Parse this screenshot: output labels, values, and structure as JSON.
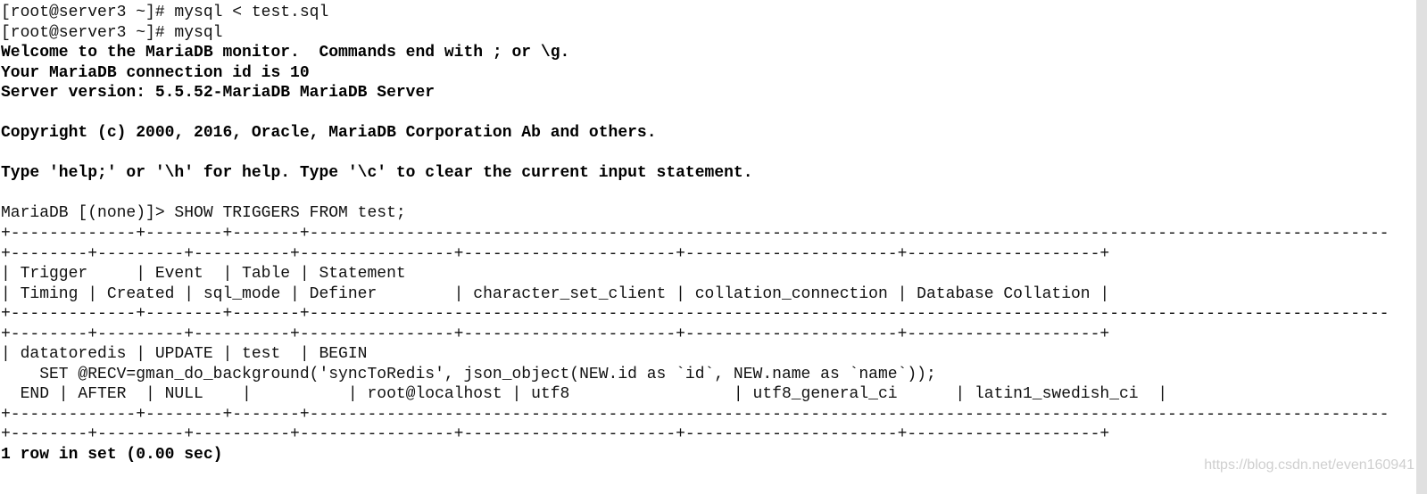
{
  "terminal": {
    "lines": [
      "[root@server3 ~]# mysql < test.sql",
      "[root@server3 ~]# mysql",
      "Welcome to the MariaDB monitor.  Commands end with ; or \\g.",
      "Your MariaDB connection id is 10",
      "Server version: 5.5.52-MariaDB MariaDB Server",
      "",
      "Copyright (c) 2000, 2016, Oracle, MariaDB Corporation Ab and others.",
      "",
      "Type 'help;' or '\\h' for help. Type '\\c' to clear the current input statement.",
      "",
      "MariaDB [(none)]> SHOW TRIGGERS FROM test;",
      "+-------------+--------+-------+--------------------------------------------------------------------------------------------------------------------------------------------------------",
      "+--------+---------+----------+----------------+----------------------+----------------------+--------------------+",
      "| Trigger     | Event  | Table | Statement",
      "| Timing | Created | sql_mode | Definer        | character_set_client | collation_connection | Database Collation |",
      "+-------------+--------+-------+--------------------------------------------------------------------------------------------------------------------------------------------------------",
      "+--------+---------+----------+----------------+----------------------+----------------------+--------------------+",
      "| datatoredis | UPDATE | test  | BEGIN",
      "    SET @RECV=gman_do_background('syncToRedis', json_object(NEW.id as `id`, NEW.name as `name`));",
      "  END | AFTER  | NULL    |          | root@localhost | utf8                 | utf8_general_ci      | latin1_swedish_ci  |",
      "+-------------+--------+-------+--------------------------------------------------------------------------------------------------------------------------------------------------------",
      "+--------+---------+----------+----------------+----------------------+----------------------+--------------------+",
      "1 row in set (0.00 sec)"
    ]
  },
  "watermark": "https://blog.csdn.net/even160941"
}
